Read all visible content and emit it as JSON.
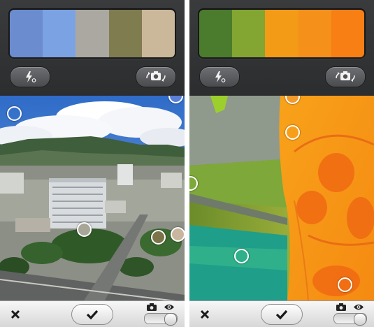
{
  "screens": [
    {
      "palette": [
        "#6b8cce",
        "#7ba2e2",
        "#aaa8a0",
        "#7f7c50",
        "#cbb89a"
      ],
      "flash_icon": "flash-auto-icon",
      "switch_icon": "switch-camera-icon",
      "markers": [
        {
          "color": "transparent"
        },
        {
          "color": "#5b7fd6"
        },
        {
          "color": "#a8a698"
        },
        {
          "color": "#7a7448"
        },
        {
          "color": "#c8b79e"
        }
      ]
    },
    {
      "palette": [
        "#4b7b2c",
        "#83a632",
        "#f39a17",
        "#f5901a",
        "#f77f14"
      ],
      "flash_icon": "flash-auto-icon",
      "switch_icon": "switch-camera-icon",
      "markers": [
        {
          "color": "#f29a2a"
        },
        {
          "color": "transparent"
        },
        {
          "color": "transparent"
        },
        {
          "color": "transparent"
        },
        {
          "color": "transparent"
        }
      ]
    }
  ],
  "bottom_bar": {
    "close_icon": "close-icon",
    "confirm_icon": "checkmark-icon",
    "mode_icons": [
      "camera-icon",
      "eye-icon"
    ],
    "mode_toggle": "eye"
  }
}
